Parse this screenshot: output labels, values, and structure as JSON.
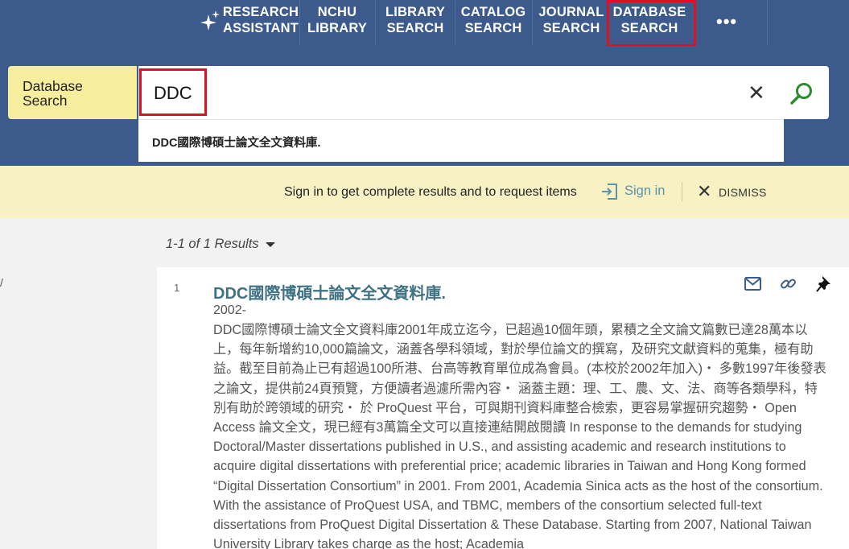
{
  "nav": {
    "items": [
      {
        "line1": "RESEARCH",
        "line2": "ASSISTANT"
      },
      {
        "line1": "NCHU",
        "line2": "LIBRARY"
      },
      {
        "line1": "LIBRARY",
        "line2": "SEARCH"
      },
      {
        "line1": "CATALOG",
        "line2": "SEARCH"
      },
      {
        "line1": "JOURNAL",
        "line2": "SEARCH"
      },
      {
        "line1": "DATABASE",
        "line2": "SEARCH"
      }
    ],
    "more": "•••"
  },
  "search": {
    "scope_line1": "Database",
    "scope_line2": "Search",
    "query": "DDC",
    "suggestion": "DDC國際博碩士論文全文資料庫."
  },
  "banner": {
    "message": "Sign in to get complete results and to request items",
    "signin": "Sign in",
    "dismiss": "DISMISS"
  },
  "results": {
    "count_text": "1-1 of 1 Results",
    "items": [
      {
        "index": "1",
        "title": "DDC國際博碩士論文全文資料庫.",
        "date": "2002-",
        "description": "DDC國際博碩士論文全文資料庫2001年成立迄今，已超過10個年頭，累積之全文論文篇數已達28萬本以上，每年新增約10,000篇論文，涵蓋各學科領域，對於學位論文的撰寫，及研究文獻資料的蒐集，極有助益。截至目前為止已有超過100所港、台高等教育單位成為會員。(本校於2002年加入)・ 多數1997年後發表之論文，提供前24頁預覽，方便讀者過濾所需內容・ 涵蓋主題：理、工、農、文、法、商等各類學科，特別有助於跨領域的研究・ 於 ProQuest 平台，可與期刊資料庫整合檢索，更容易掌握研究趨勢・ Open Access 論文全文，現已經有3萬篇全文可以直接連結開啟閱讀 In response to the demands for studying Doctoral/Master dissertations published in U.S., and assisting academic and research institutions to acquire digital dissertations with preferential price; academic libraries in Taiwan and Hong Kong formed “Digital Dissertation Consortium” in 2001. From 2001, Academia Sinica acts as the host of the consortium. With the assistance of ProQuest USA, and TBMC, members of the consortium selected full-text dissertations from ProQuest Digital Dissertation & These Database. Starting from 2007, National Taiwan University Library takes charge as the host; Academia"
      }
    ]
  },
  "colors": {
    "nav_bg": "#3c5a8c",
    "highlight": "#e0101f",
    "scope_bg": "#f6ee9e",
    "banner_bg": "#f7f1c4",
    "title": "#3f7283",
    "search_icon": "#2e8b2e"
  }
}
